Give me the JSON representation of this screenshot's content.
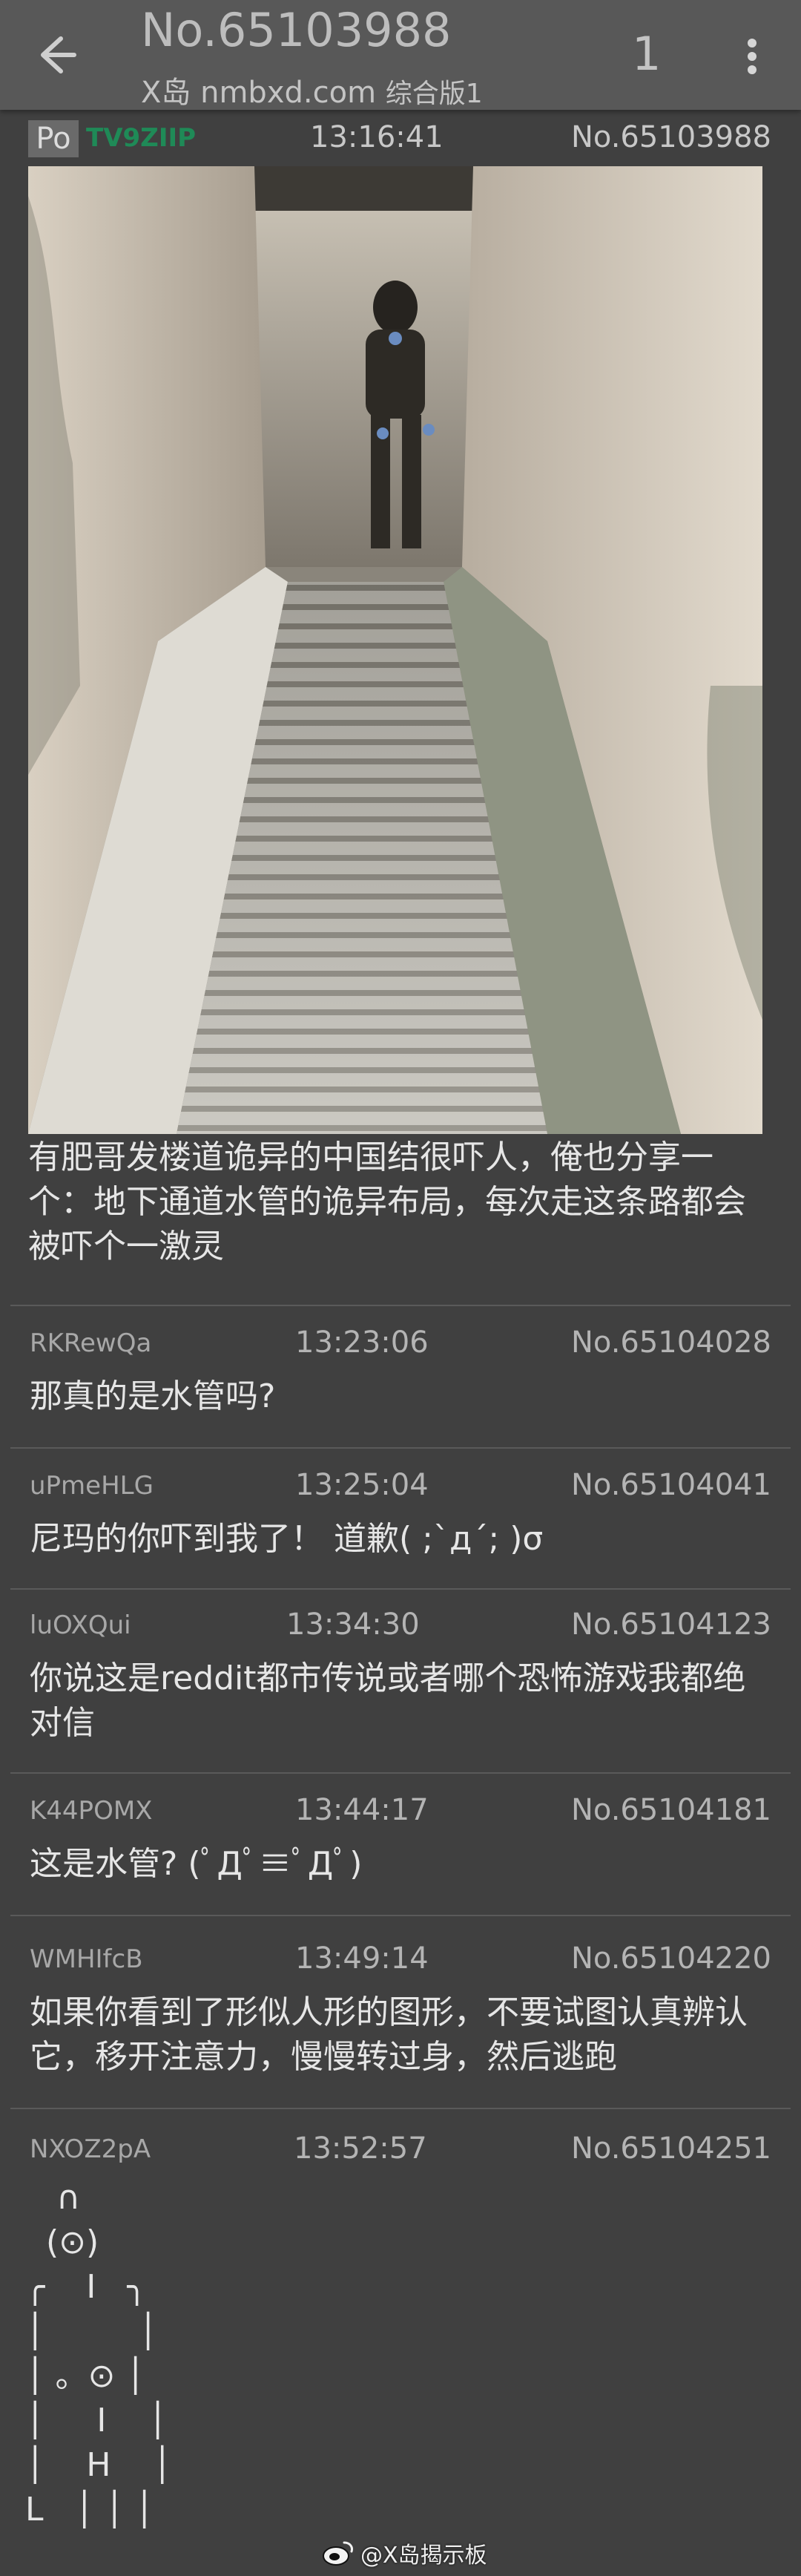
{
  "header": {
    "thread_title": "No.65103988",
    "site": "X岛 nmbxd.com",
    "board": "综合版1",
    "page": "1"
  },
  "op": {
    "badge": "Po",
    "uid": "TV9ZIIP",
    "time": "13:16:41",
    "no": "No.65103988",
    "text": "有肥哥发楼道诡异的中国结很吓人，俺也分享一个：地下通道水管的诡异布局，每次走这条路都会被吓个一激灵"
  },
  "replies": [
    {
      "uid": "RKRewQa",
      "time": "13:23:06",
      "no": "No.65104028",
      "text": "那真的是水管吗?"
    },
    {
      "uid": "uPmeHLG",
      "time": "13:25:04",
      "no": "No.65104041",
      "text": "尼玛的你吓到我了！ 道歉( ;`д´; )σ"
    },
    {
      "uid": "luOXQui",
      "time": "13:34:30",
      "no": "No.65104123",
      "text": "你说这是reddit都市传说或者哪个恐怖游戏我都绝对信"
    },
    {
      "uid": "K44POMX",
      "time": "13:44:17",
      "no": "No.65104181",
      "text": "这是水管? (ﾟДﾟ≡ﾟДﾟ)"
    },
    {
      "uid": "WMHIfcB",
      "time": "13:49:14",
      "no": "No.65104220",
      "text": "如果你看到了形似人形的图形，不要试图认真辨认它，移开注意力，慢慢转过身，然后逃跑"
    },
    {
      "uid": "NXOZ2pA",
      "time": "13:52:57",
      "no": "No.65104251",
      "text": ""
    }
  ],
  "ascii_art": [
    "   ∩",
    "  (⊙)",
    "╭    I   ╮",
    "│         │",
    "│ 。⊙ │",
    "│     I    │",
    "│    H    │",
    "L   │ │ │"
  ],
  "watermark": "@X岛揭示板",
  "colors": {
    "appbar": "#585858",
    "background": "#404040",
    "po_uid": "#1f8a57"
  }
}
